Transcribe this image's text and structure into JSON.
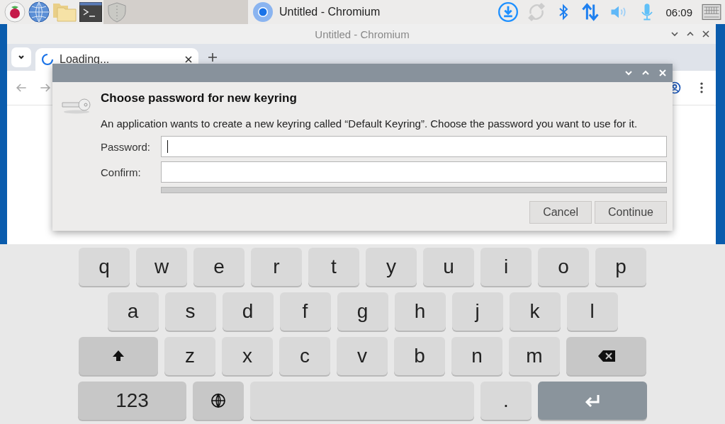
{
  "taskbar": {
    "window_button": {
      "title": "Untitled - Chromium"
    },
    "clock": "06:09"
  },
  "browser": {
    "title": "Untitled - Chromium",
    "tabs": [
      {
        "label": "Loading...",
        "selected": true
      }
    ]
  },
  "dialog": {
    "heading": "Choose password for new keyring",
    "message": "An application wants to create a new keyring called “Default Keyring”. Choose the password you want to use for it.",
    "fields": [
      {
        "label": "Password:",
        "focused": true
      },
      {
        "label": "Confirm:",
        "focused": false
      }
    ],
    "buttons": [
      "Cancel",
      "Continue"
    ]
  },
  "keyboard": {
    "rows": [
      [
        {
          "kind": "letter",
          "label": "q"
        },
        {
          "kind": "letter",
          "label": "w"
        },
        {
          "kind": "letter",
          "label": "e"
        },
        {
          "kind": "letter",
          "label": "r"
        },
        {
          "kind": "letter",
          "label": "t"
        },
        {
          "kind": "letter",
          "label": "y"
        },
        {
          "kind": "letter",
          "label": "u"
        },
        {
          "kind": "letter",
          "label": "i"
        },
        {
          "kind": "letter",
          "label": "o"
        },
        {
          "kind": "letter",
          "label": "p"
        }
      ],
      [
        {
          "kind": "letter",
          "label": "a"
        },
        {
          "kind": "letter",
          "label": "s"
        },
        {
          "kind": "letter",
          "label": "d"
        },
        {
          "kind": "letter",
          "label": "f"
        },
        {
          "kind": "letter",
          "label": "g"
        },
        {
          "kind": "letter",
          "label": "h"
        },
        {
          "kind": "letter",
          "label": "j"
        },
        {
          "kind": "letter",
          "label": "k"
        },
        {
          "kind": "letter",
          "label": "l"
        }
      ],
      [
        {
          "kind": "shift"
        },
        {
          "kind": "letter",
          "label": "z"
        },
        {
          "kind": "letter",
          "label": "x"
        },
        {
          "kind": "letter",
          "label": "c"
        },
        {
          "kind": "letter",
          "label": "v"
        },
        {
          "kind": "letter",
          "label": "b"
        },
        {
          "kind": "letter",
          "label": "n"
        },
        {
          "kind": "letter",
          "label": "m"
        },
        {
          "kind": "backspace"
        }
      ],
      [
        {
          "kind": "mode",
          "label": "123"
        },
        {
          "kind": "globe"
        },
        {
          "kind": "space"
        },
        {
          "kind": "letter",
          "label": "."
        },
        {
          "kind": "enter"
        }
      ]
    ]
  }
}
